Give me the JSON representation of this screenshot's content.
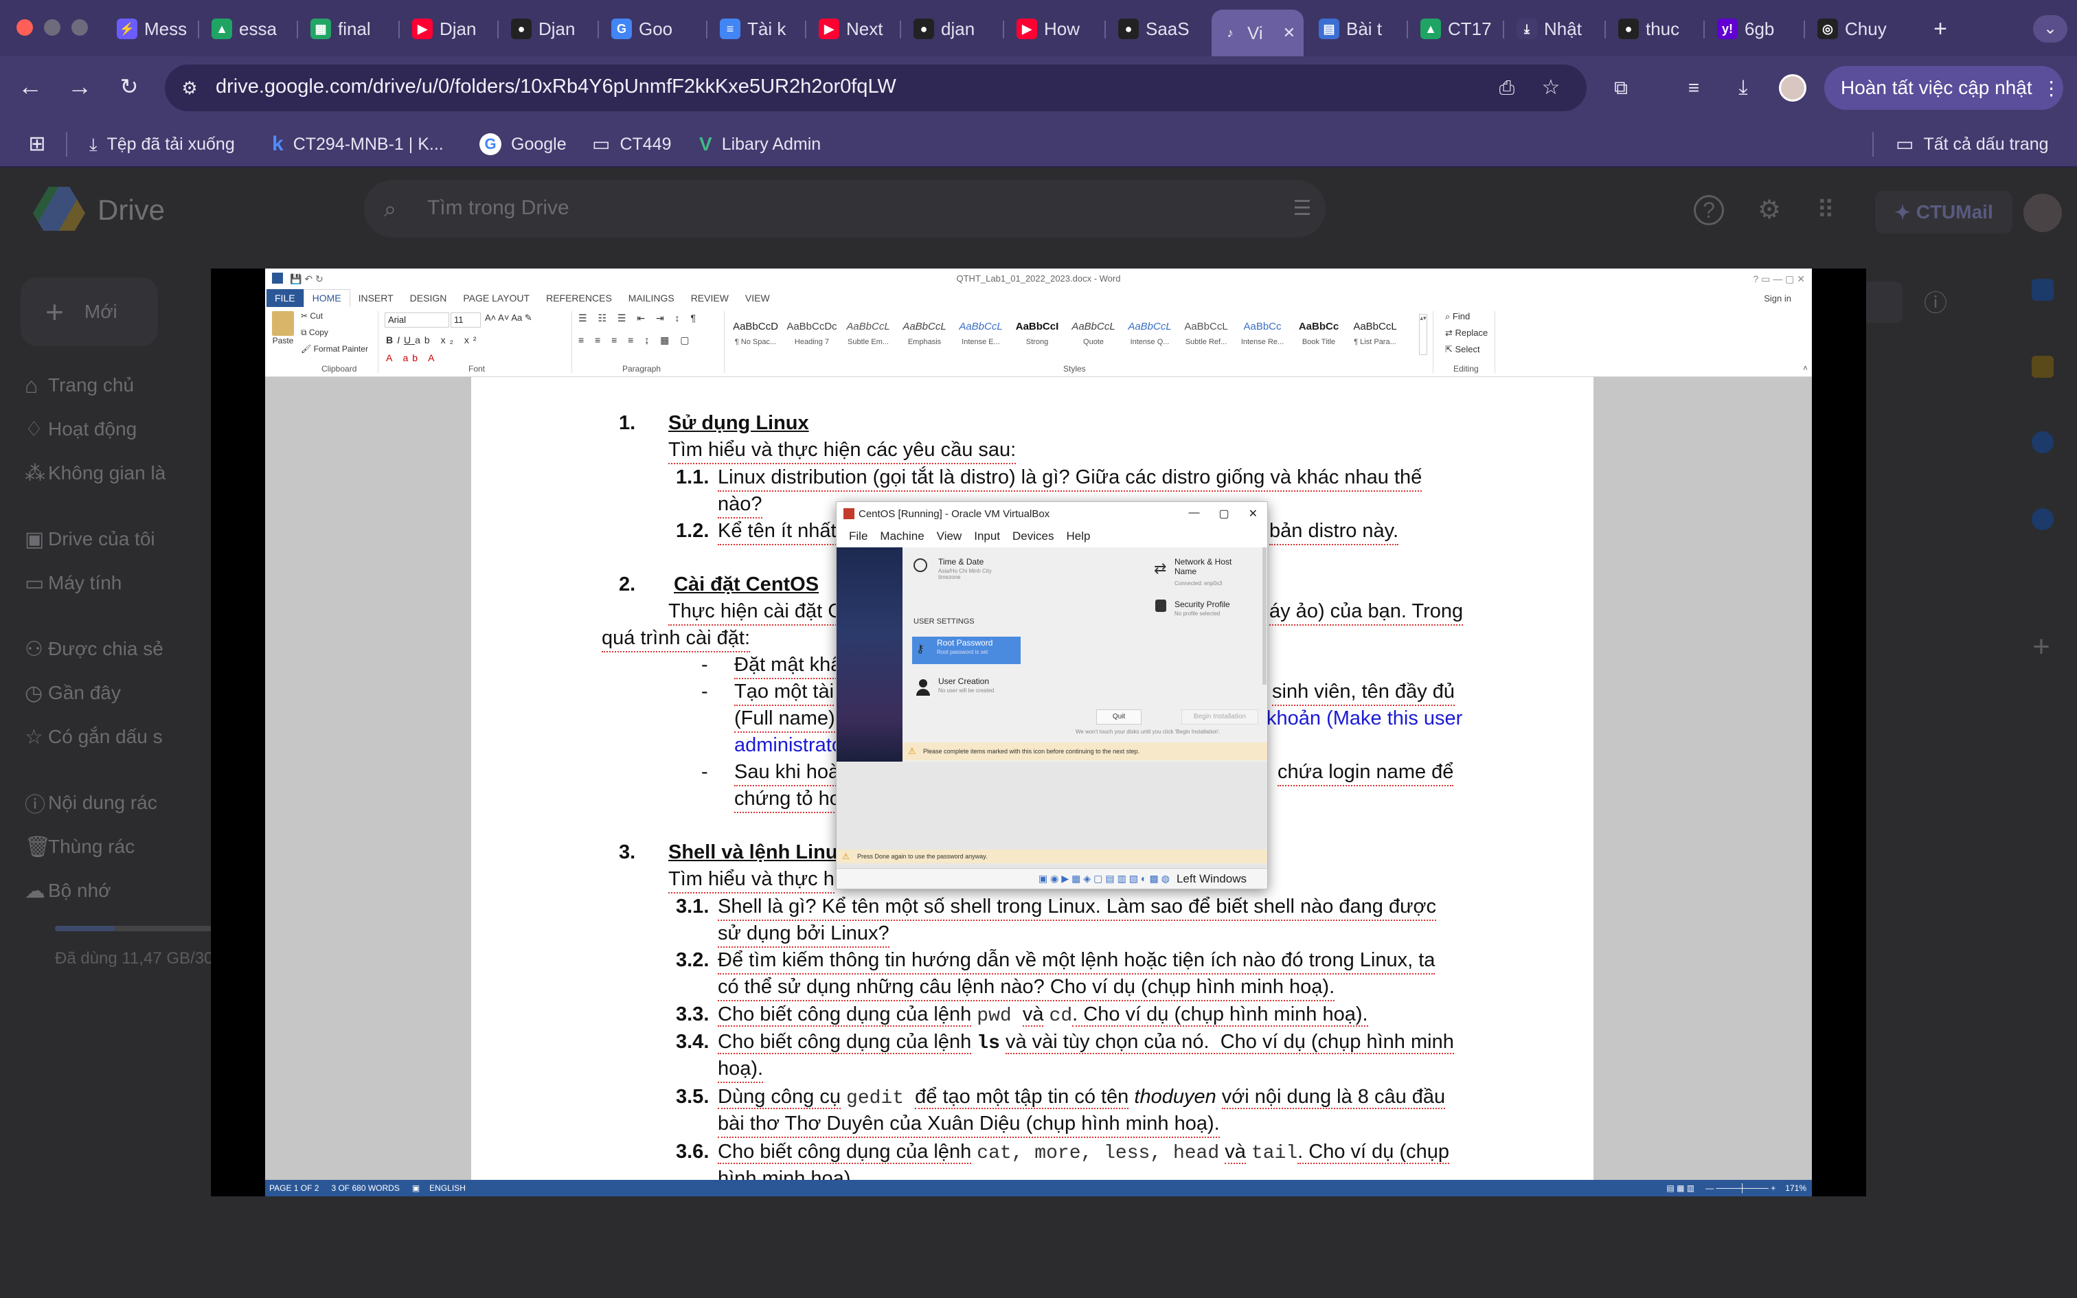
{
  "browser": {
    "tabs": [
      {
        "label": "Mess",
        "icon": "messenger-icon",
        "color": "#6a5cff"
      },
      {
        "label": "essa",
        "icon": "google-drive-icon",
        "color": "#1fa463"
      },
      {
        "label": "final",
        "icon": "google-sheets-icon",
        "color": "#23a566"
      },
      {
        "label": "Djan",
        "icon": "youtube-icon",
        "color": "#ff0033"
      },
      {
        "label": "Djan",
        "icon": "github-icon",
        "color": "#222222"
      },
      {
        "label": "Goo",
        "icon": "google-translate-icon",
        "color": "#4285f4"
      },
      {
        "label": "Tài k",
        "icon": "google-docs-icon",
        "color": "#4285f4"
      },
      {
        "label": "Next",
        "icon": "youtube-icon",
        "color": "#ff0033"
      },
      {
        "label": "djan",
        "icon": "github-icon",
        "color": "#222222"
      },
      {
        "label": "How",
        "icon": "youtube-icon",
        "color": "#ff0033"
      },
      {
        "label": "SaaS",
        "icon": "github-icon",
        "color": "#222222"
      },
      {
        "label": "Vi",
        "icon": "speaker-icon",
        "color": "#6a5fa0",
        "active": true
      },
      {
        "label": "Bài t",
        "icon": "google-classroom-icon",
        "color": "#3b6fd4"
      },
      {
        "label": "CT17",
        "icon": "google-drive-icon",
        "color": "#1fa463"
      },
      {
        "label": "Nhật",
        "icon": "download-icon",
        "color": "#433a6e"
      },
      {
        "label": "thuc",
        "icon": "github-icon",
        "color": "#222222"
      },
      {
        "label": "6gb",
        "icon": "yahoo-icon",
        "color": "#6001d2"
      },
      {
        "label": "Chuy",
        "icon": "chatgpt-icon",
        "color": "#222222"
      }
    ],
    "url": "drive.google.com/drive/u/0/folders/10xRb4Y6pUnmfF2kkKxe5UR2h2or0fqLW",
    "update_button": "Hoàn tất việc cập nhật",
    "bookmarks": [
      "Tệp đã tải xuống",
      "CT294-MNB-1 | K...",
      "Google",
      "CT449",
      "Libary Admin"
    ],
    "all_bookmarks": "Tất cả dấu trang"
  },
  "drive": {
    "logo": "Drive",
    "search_placeholder": "Tìm trong Drive",
    "new_button": "Mới",
    "nav": [
      "Trang chủ",
      "Hoạt động",
      "Không gian là",
      "Drive của tôi",
      "Máy tính",
      "Được chia sẻ",
      "Gần đây",
      "Có gắn dấu s",
      "Nội dung rác",
      "Thùng rác",
      "Bộ nhớ"
    ],
    "storage": "Đã dùng 11,47 GB/30",
    "ctumail": "CTUMail"
  },
  "word": {
    "title": "QTHT_Lab1_01_2022_2023.docx - Word",
    "signin": "Sign in",
    "tabs": [
      "FILE",
      "HOME",
      "INSERT",
      "DESIGN",
      "PAGE LAYOUT",
      "REFERENCES",
      "MAILINGS",
      "REVIEW",
      "VIEW"
    ],
    "clipboard": {
      "paste": "Paste",
      "cut": "Cut",
      "copy": "Copy",
      "format_painter": "Format Painter",
      "label": "Clipboard"
    },
    "font": {
      "name": "Arial",
      "size": "11",
      "label": "Font"
    },
    "paragraph_label": "Paragraph",
    "styles": [
      {
        "preview": "AaBbCcD",
        "name": "¶ No Spac..."
      },
      {
        "preview": "AaBbCcDc",
        "name": "Heading 7"
      },
      {
        "preview": "AaBbCcL",
        "name": "Subtle Em..."
      },
      {
        "preview": "AaBbCcL",
        "name": "Emphasis"
      },
      {
        "preview": "AaBbCcL",
        "name": "Intense E..."
      },
      {
        "preview": "AaBbCcI",
        "name": "Strong"
      },
      {
        "preview": "AaBbCcL",
        "name": "Quote"
      },
      {
        "preview": "AaBbCcL",
        "name": "Intense Q..."
      },
      {
        "preview": "AaBbCcL",
        "name": "Subtle Ref..."
      },
      {
        "preview": "AaBbCc",
        "name": "Intense Re..."
      },
      {
        "preview": "AaBbCc",
        "name": "Book Title"
      },
      {
        "preview": "AaBbCcL",
        "name": "¶ List Para..."
      }
    ],
    "styles_label": "Styles",
    "editing": {
      "find": "Find",
      "replace": "Replace",
      "select": "Select",
      "label": "Editing"
    },
    "doc": {
      "s1_num": "1.",
      "s1_title": "Sử dụng Linux",
      "s1_intro": "Tìm hiểu và thực hiện các yêu cầu sau:",
      "q11_num": "1.1.",
      "q11_a": "Linux distribution (gọi tắt là distro) là gì? Giữa các distro giống và khác nhau thế",
      "q11_b": "nào?",
      "q12_num": "1.2.",
      "q12_a": "Kể tên ít nhất",
      "q12_b": "bản distro này.",
      "s2_num": "2.",
      "s2_title": "Cài đặt CentOS",
      "s2_a": "Thực hiện cài đặt C",
      "s2_b": "áy ảo) của bạn. Trong",
      "s2_c": "quá trình cài đặt:",
      "b1": "Đặt mật khẩ",
      "b2_a": "Tạo một tài",
      "b2_b": "sinh viên, tên đầy đủ",
      "b2_c": "(Full name)",
      "b2_d": "khoản (Make this user",
      "b2_e": "administrato",
      "b3_a": "Sau khi hoà",
      "b3_b": "chứa login name để",
      "b3_c": "chứng tỏ hơ",
      "s3_num": "3.",
      "s3_title": "Shell và lệnh Linu",
      "s3_intro": "Tìm hiểu và thực h",
      "q31_num": "3.1.",
      "q31_a": "Shell là gì? Kể tên một số shell trong Linux. Làm sao để biết shell nào đang được",
      "q31_b": "sử dụng bởi Linux?",
      "q32_num": "3.2.",
      "q32_a": "Để tìm kiếm thông tin hướng dẫn về một lệnh hoặc tiện ích nào đó trong Linux, ta",
      "q32_b": "có thể sử dụng những câu lệnh nào? Cho ví dụ (chụp hình minh hoạ).",
      "q33_num": "3.3.",
      "q33_a": "Cho biết công dụng của lệnh",
      "q33_cmd1": "pwd",
      "q33_and": "và",
      "q33_cmd2": "cd",
      "q33_b": ". Cho ví dụ (chụp hình minh hoạ).",
      "q34_num": "3.4.",
      "q34_a": "Cho biết công dụng của lệnh",
      "q34_cmd": "ls",
      "q34_b": "và vài tùy chọn của nó.  Cho ví dụ (chụp hình minh",
      "q34_c": "hoạ).",
      "q35_num": "3.5.",
      "q35_a": "Dùng công cụ",
      "q35_cmd": "gedit",
      "q35_b": "để tạo một tập tin có tên",
      "q35_name": "thoduyen",
      "q35_c": "với nội dung là 8 câu đầu",
      "q35_d": "bài thơ Thơ Duyên của Xuân Diệu (chụp hình minh hoạ).",
      "q36_num": "3.6.",
      "q36_a": "Cho biết công dụng của lệnh",
      "q36_cmds": "cat, more, less, head",
      "q36_and": "và",
      "q36_cmd2": "tail",
      "q36_b": ". Cho ví dụ (chụp",
      "q36_c": "hình minh hoạ)."
    },
    "status": {
      "page": "PAGE 1 OF 2",
      "words": "3 OF 680 WORDS",
      "lang": "ENGLISH",
      "zoom": "171%"
    }
  },
  "vm": {
    "title": "CentOS [Running] - Oracle VM VirtualBox",
    "menu": [
      "File",
      "Machine",
      "View",
      "Input",
      "Devices",
      "Help"
    ],
    "time_title": "Time & Date",
    "time_sub": "Asia/Ho Chi Minh City timezone",
    "network_title": "Network & Host Name",
    "network_sub": "Connected: enp0s3",
    "security_title": "Security Profile",
    "security_sub": "No profile selected",
    "user_settings": "USER SETTINGS",
    "root_title": "Root Password",
    "root_sub": "Root password is set",
    "user_title": "User Creation",
    "user_sub": "No user will be created",
    "quit": "Quit",
    "begin": "Begin Installation",
    "disk_note": "We won't touch your disks until you click 'Begin Installation'.",
    "warning": "Please complete items marked with this icon before continuing to the next step.",
    "done_note": "Press Done again to use the password anyway.",
    "host_key": "Left Windows"
  }
}
